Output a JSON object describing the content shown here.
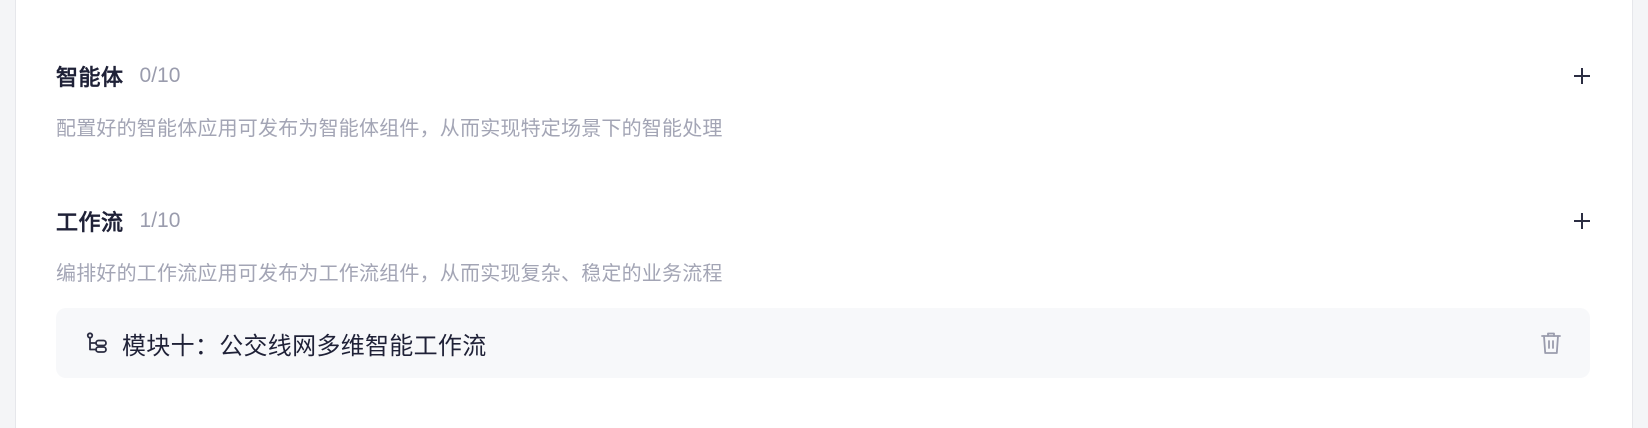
{
  "agents": {
    "title": "智能体",
    "count": "0/10",
    "description": "配置好的智能体应用可发布为智能体组件，从而实现特定场景下的智能处理"
  },
  "workflows": {
    "title": "工作流",
    "count": "1/10",
    "description": "编排好的工作流应用可发布为工作流组件，从而实现复杂、稳定的业务流程",
    "items": [
      {
        "label": "模块十：公交线网多维智能工作流",
        "icon": "workflow-icon"
      }
    ]
  },
  "colors": {
    "title": "#1f2137",
    "muted": "#a3a5b5",
    "card_bg": "#f7f8fa",
    "icon": "#2b2d42",
    "delete_icon": "#9a9cad"
  }
}
